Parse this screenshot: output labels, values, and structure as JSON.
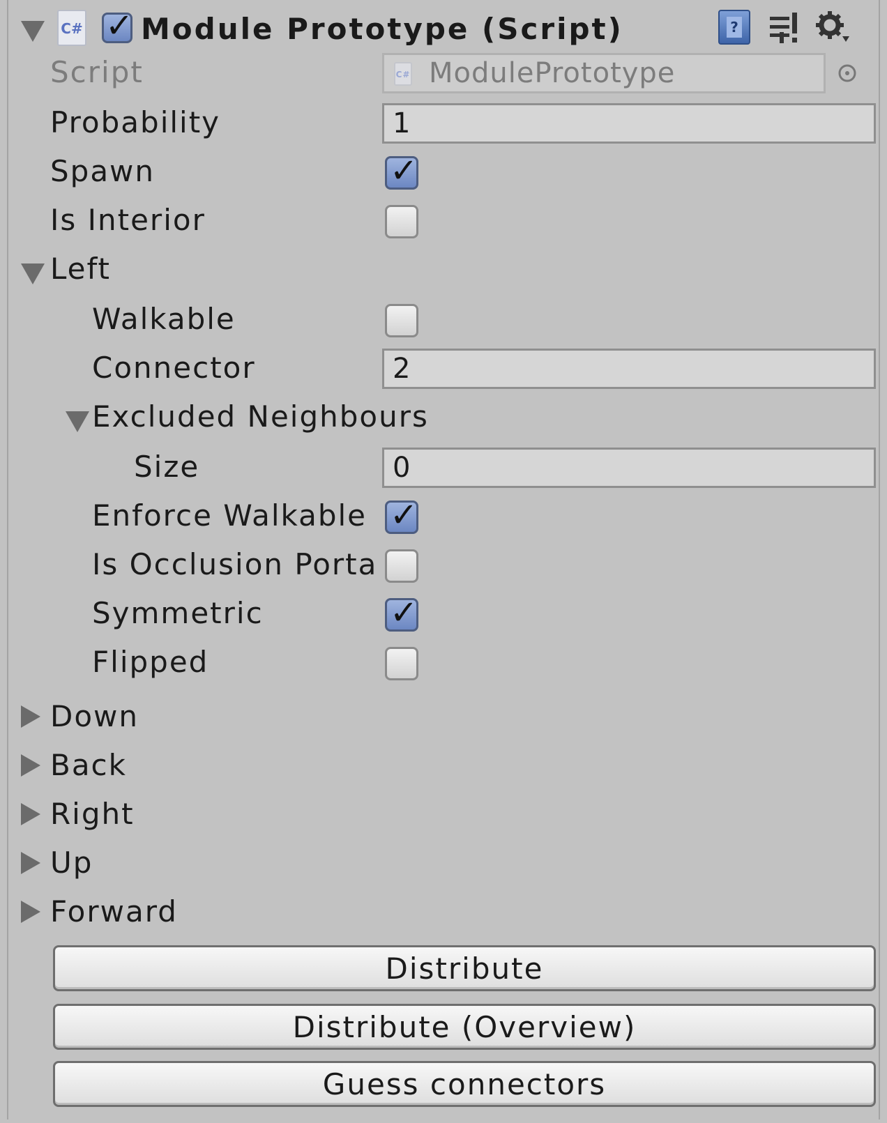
{
  "component": {
    "title": "Module Prototype (Script)",
    "enabled": true,
    "icons": [
      "fold-down-icon",
      "csharp-script-icon",
      "help-book-icon",
      "presets-icon",
      "gear-icon"
    ],
    "cs_glyph": "C#"
  },
  "fields": {
    "script_label": "Script",
    "script_value": "ModulePrototype",
    "probability_label": "Probability",
    "probability_value": "1",
    "spawn_label": "Spawn",
    "spawn_checked": true,
    "is_interior_label": "Is Interior",
    "is_interior_checked": false
  },
  "left": {
    "label": "Left",
    "expanded": true,
    "walkable_label": "Walkable",
    "walkable_checked": false,
    "connector_label": "Connector",
    "connector_value": "2",
    "excluded_label": "Excluded Neighbours",
    "size_label": "Size",
    "size_value": "0",
    "enforce_walkable_label": "Enforce Walkable",
    "enforce_walkable_checked": true,
    "is_occlusion_label": "Is Occlusion Porta",
    "is_occlusion_checked": false,
    "symmetric_label": "Symmetric",
    "symmetric_checked": true,
    "flipped_label": "Flipped",
    "flipped_checked": false
  },
  "sections": {
    "down": "Down",
    "back": "Back",
    "right": "Right",
    "up": "Up",
    "forward": "Forward"
  },
  "buttons": {
    "distribute": "Distribute",
    "distribute_overview": "Distribute (Overview)",
    "guess_connectors": "Guess connectors"
  },
  "colors": {
    "background": "#c2c2c2",
    "check_on": "#7f97cf",
    "field_bg": "#d6d6d6"
  }
}
